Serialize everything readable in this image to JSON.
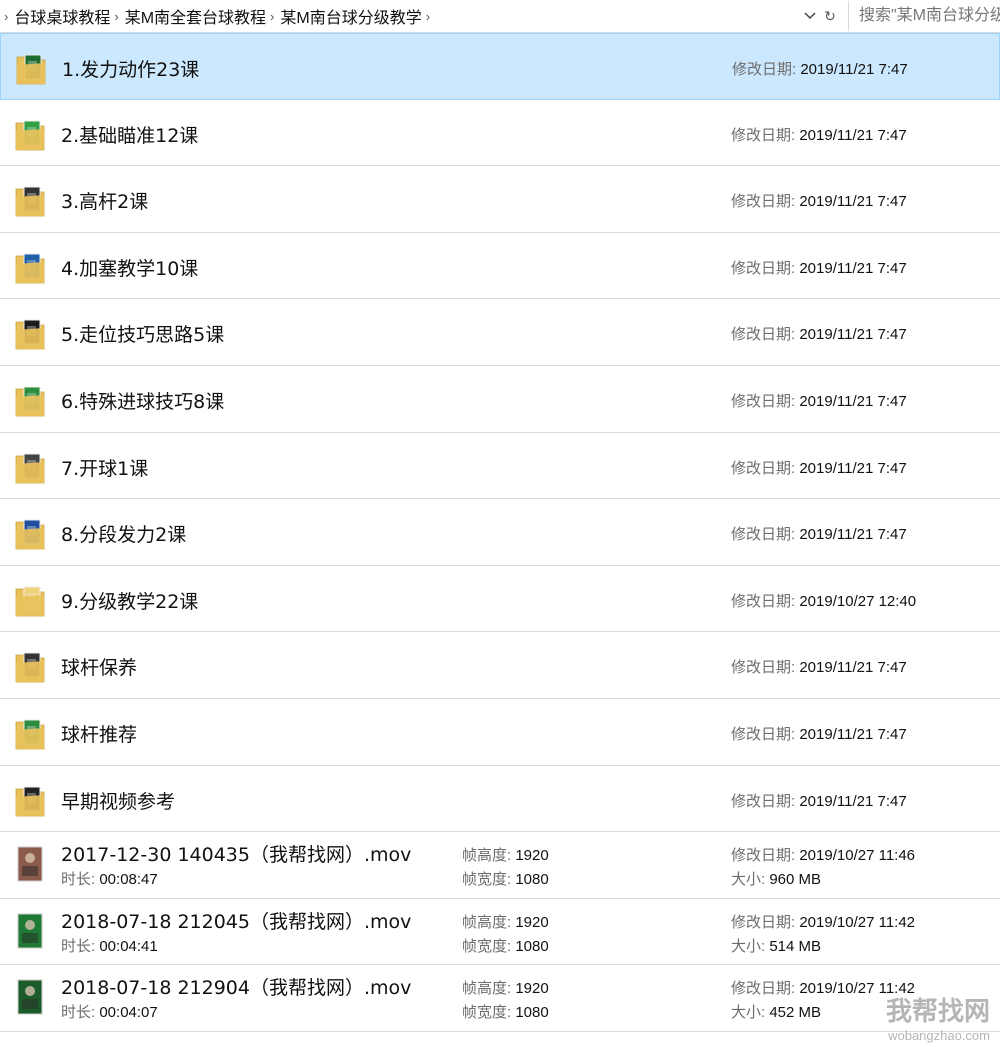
{
  "address": {
    "crumbs": [
      "台球桌球教程",
      "某M南全套台球教程",
      "某M南台球分级教学"
    ],
    "search_placeholder": "搜索\"某M南台球分级教学\""
  },
  "labels": {
    "modified": "修改日期:",
    "duration": "时长:",
    "frame_height": "帧高度:",
    "frame_width": "帧宽度:",
    "size": "大小:"
  },
  "folders": [
    {
      "name": "1.发力动作23课",
      "date": "2019/11/21 7:47",
      "selected": true
    },
    {
      "name": "2.基础瞄准12课",
      "date": "2019/11/21 7:47"
    },
    {
      "name": "3.高杆2课",
      "date": "2019/11/21 7:47"
    },
    {
      "name": "4.加塞教学10课",
      "date": "2019/11/21 7:47"
    },
    {
      "name": "5.走位技巧思路5课",
      "date": "2019/11/21 7:47"
    },
    {
      "name": "6.特殊进球技巧8课",
      "date": "2019/11/21 7:47"
    },
    {
      "name": "7.开球1课",
      "date": "2019/11/21 7:47"
    },
    {
      "name": "8.分段发力2课",
      "date": "2019/11/21 7:47"
    },
    {
      "name": "9.分级教学22课",
      "date": "2019/10/27 12:40"
    },
    {
      "name": "球杆保养",
      "date": "2019/11/21 7:47"
    },
    {
      "name": "球杆推荐",
      "date": "2019/11/21 7:47"
    },
    {
      "name": "早期视频参考",
      "date": "2019/11/21 7:47"
    }
  ],
  "videos": [
    {
      "name": "2017-12-30 140435（我帮找网）.mov",
      "duration": "00:08:47",
      "height": "1920",
      "width": "1080",
      "date": "2019/10/27 11:46",
      "size": "960 MB"
    },
    {
      "name": "2018-07-18 212045（我帮找网）.mov",
      "duration": "00:04:41",
      "height": "1920",
      "width": "1080",
      "date": "2019/10/27 11:42",
      "size": "514 MB"
    },
    {
      "name": "2018-07-18 212904（我帮找网）.mov",
      "duration": "00:04:07",
      "height": "1920",
      "width": "1080",
      "date": "2019/10/27 11:42",
      "size": "452 MB"
    }
  ],
  "watermark": {
    "top": "我帮找网",
    "bottom": "wobangzhao.com"
  },
  "colors": {
    "selection": "#cce8ff",
    "folder": "#e8c15a",
    "label": "#6d6d6d"
  }
}
